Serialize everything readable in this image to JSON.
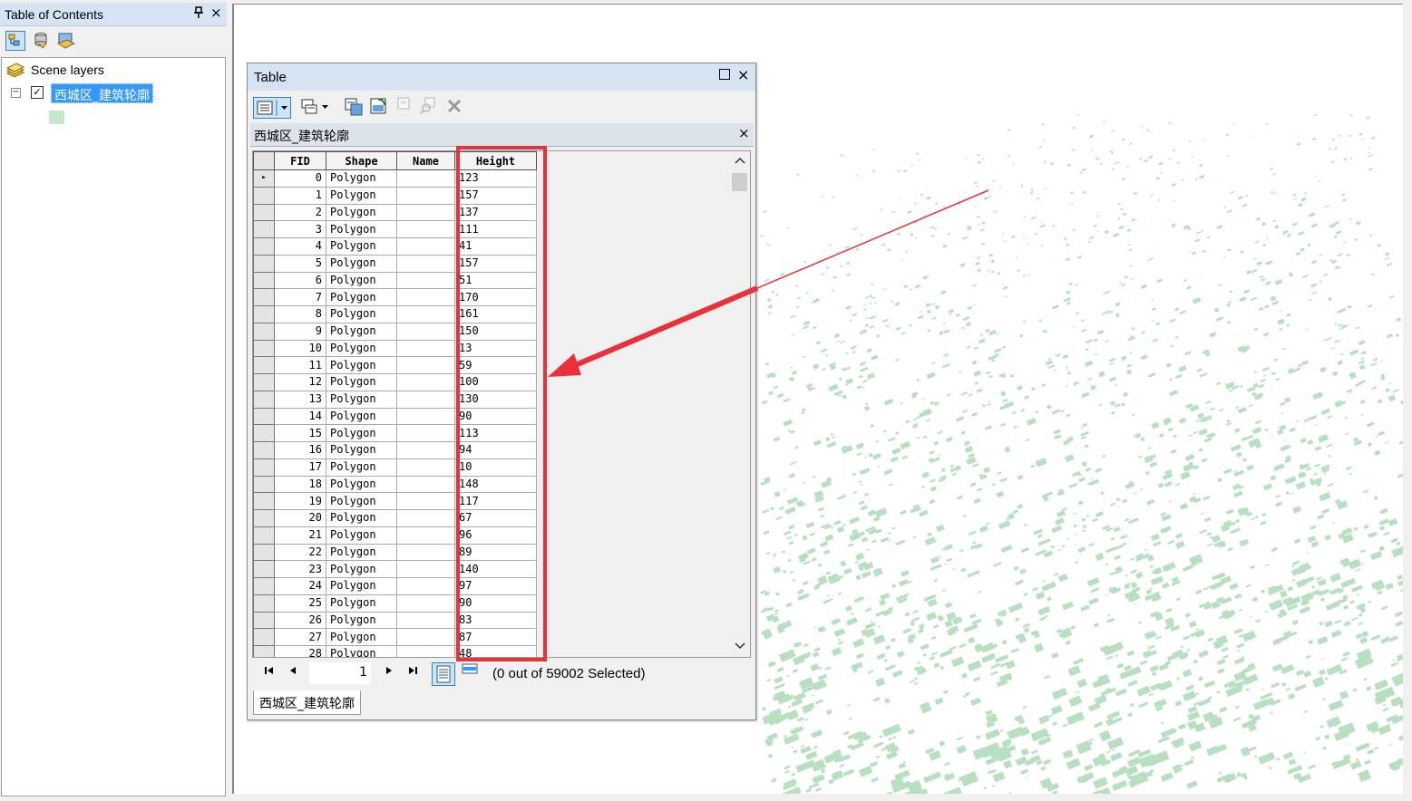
{
  "toc": {
    "title": "Table of Contents",
    "pin": "ᵖ",
    "close": "×",
    "toolbar_icons": [
      "list-by-drawing-order-icon",
      "list-by-source-icon",
      "list-by-visibility-icon"
    ],
    "scene_layers_label": "Scene layers",
    "layer": {
      "name": "西城区_建筑轮廓",
      "checked": "✓",
      "expand": "−",
      "swatch_color": "#c8e6cc"
    }
  },
  "table_window": {
    "title": "Table",
    "close": "×",
    "tab_label": "西城区_建筑轮廓",
    "tab_close": "×",
    "columns": [
      "FID",
      "Shape",
      "Name",
      "Height"
    ],
    "rows": [
      {
        "fid": "0",
        "shape": "Polygon",
        "name": "",
        "height": "123"
      },
      {
        "fid": "1",
        "shape": "Polygon",
        "name": "",
        "height": "157"
      },
      {
        "fid": "2",
        "shape": "Polygon",
        "name": "",
        "height": "137"
      },
      {
        "fid": "3",
        "shape": "Polygon",
        "name": "",
        "height": "111"
      },
      {
        "fid": "4",
        "shape": "Polygon",
        "name": "",
        "height": "41"
      },
      {
        "fid": "5",
        "shape": "Polygon",
        "name": "",
        "height": "157"
      },
      {
        "fid": "6",
        "shape": "Polygon",
        "name": "",
        "height": "51"
      },
      {
        "fid": "7",
        "shape": "Polygon",
        "name": "",
        "height": "170"
      },
      {
        "fid": "8",
        "shape": "Polygon",
        "name": "",
        "height": "161"
      },
      {
        "fid": "9",
        "shape": "Polygon",
        "name": "",
        "height": "150"
      },
      {
        "fid": "10",
        "shape": "Polygon",
        "name": "",
        "height": "13"
      },
      {
        "fid": "11",
        "shape": "Polygon",
        "name": "",
        "height": "59"
      },
      {
        "fid": "12",
        "shape": "Polygon",
        "name": "",
        "height": "100"
      },
      {
        "fid": "13",
        "shape": "Polygon",
        "name": "",
        "height": "130"
      },
      {
        "fid": "14",
        "shape": "Polygon",
        "name": "",
        "height": "90"
      },
      {
        "fid": "15",
        "shape": "Polygon",
        "name": "",
        "height": "113"
      },
      {
        "fid": "16",
        "shape": "Polygon",
        "name": "",
        "height": "94"
      },
      {
        "fid": "17",
        "shape": "Polygon",
        "name": "",
        "height": "10"
      },
      {
        "fid": "18",
        "shape": "Polygon",
        "name": "",
        "height": "148"
      },
      {
        "fid": "19",
        "shape": "Polygon",
        "name": "",
        "height": "117"
      },
      {
        "fid": "20",
        "shape": "Polygon",
        "name": "",
        "height": "67"
      },
      {
        "fid": "21",
        "shape": "Polygon",
        "name": "",
        "height": "96"
      },
      {
        "fid": "22",
        "shape": "Polygon",
        "name": "",
        "height": "89"
      },
      {
        "fid": "23",
        "shape": "Polygon",
        "name": "",
        "height": "140"
      },
      {
        "fid": "24",
        "shape": "Polygon",
        "name": "",
        "height": "97"
      },
      {
        "fid": "25",
        "shape": "Polygon",
        "name": "",
        "height": "90"
      },
      {
        "fid": "26",
        "shape": "Polygon",
        "name": "",
        "height": "83"
      },
      {
        "fid": "27",
        "shape": "Polygon",
        "name": "",
        "height": "87"
      },
      {
        "fid": "28",
        "shape": "Polygon",
        "name": "",
        "height": "48"
      }
    ],
    "current_row_marker": "▸",
    "nav": {
      "first": "⏮",
      "prev": "◀",
      "record": "1",
      "next": "▶",
      "last": "⏭",
      "selected_status": "(0 out of 59002 Selected)"
    },
    "bottom_tab": "西城区_建筑轮廓"
  },
  "colors": {
    "highlight": "#e8313a",
    "buildings": "#b9dfc1",
    "selection": "#3399ff"
  }
}
